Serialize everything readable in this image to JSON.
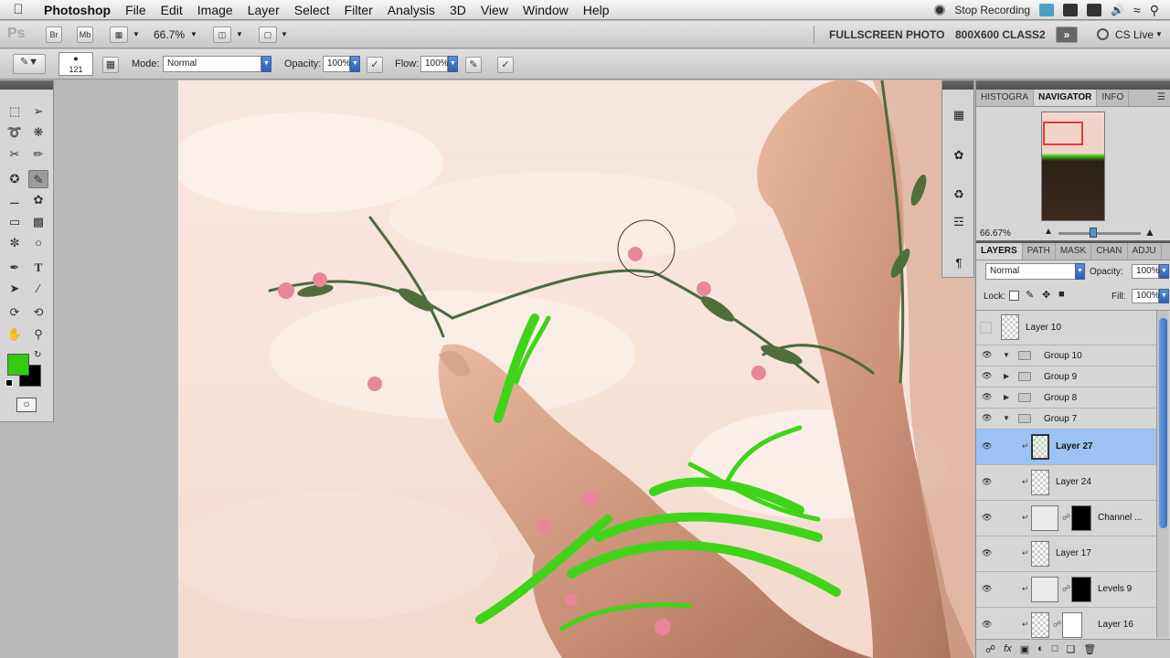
{
  "menubar": {
    "app_name": "Photoshop",
    "menus": [
      "File",
      "Edit",
      "Image",
      "Layer",
      "Select",
      "Filter",
      "Analysis",
      "3D",
      "View",
      "Window",
      "Help"
    ],
    "stop_recording": "Stop Recording"
  },
  "appbar": {
    "logo": "Ps",
    "br": "Br",
    "mb": "Mb",
    "zoom": "66.7%",
    "workspace1": "FULLSCREEN PHOTO",
    "workspace2": "800X600 CLASS2",
    "cs_live": "CS Live"
  },
  "options": {
    "brush_size": "121",
    "mode_label": "Mode:",
    "mode_value": "Normal",
    "opacity_label": "Opacity:",
    "opacity_value": "100%",
    "flow_label": "Flow:",
    "flow_value": "100%"
  },
  "colors": {
    "foreground": "#33cc11",
    "background": "#000000",
    "selection": "#9dc3f5",
    "accent": "#2c5fb5"
  },
  "navigator": {
    "tabs": [
      "HISTOGRA",
      "NAVIGATOR",
      "INFO"
    ],
    "active_tab": "NAVIGATOR",
    "zoom": "66.67%"
  },
  "layers_panel": {
    "tabs": [
      "LAYERS",
      "PATH",
      "MASK",
      "CHAN",
      "ADJU"
    ],
    "active_tab": "LAYERS",
    "blend_mode": "Normal",
    "opacity_label": "Opacity:",
    "opacity_value": "100%",
    "lock_label": "Lock:",
    "fill_label": "Fill:",
    "fill_value": "100%",
    "layers": [
      {
        "name": "Layer 10",
        "type": "layer",
        "visible": false,
        "selected": false
      },
      {
        "name": "Group 10",
        "type": "group",
        "visible": true,
        "expanded": true
      },
      {
        "name": "Group 9",
        "type": "group",
        "visible": true,
        "expanded": false
      },
      {
        "name": "Group 8",
        "type": "group",
        "visible": true,
        "expanded": false
      },
      {
        "name": "Group 7",
        "type": "group",
        "visible": true,
        "expanded": true
      },
      {
        "name": "Layer 27",
        "type": "layer",
        "visible": true,
        "selected": true
      },
      {
        "name": "Layer 24",
        "type": "layer",
        "visible": true,
        "selected": false
      },
      {
        "name": "Channel ...",
        "type": "adjustment",
        "visible": true,
        "selected": false
      },
      {
        "name": "Layer 17",
        "type": "layer",
        "visible": true,
        "selected": false
      },
      {
        "name": "Levels 9",
        "type": "adjustment",
        "visible": true,
        "selected": false
      },
      {
        "name": "Layer 16",
        "type": "layer",
        "visible": true,
        "selected": false
      }
    ]
  }
}
